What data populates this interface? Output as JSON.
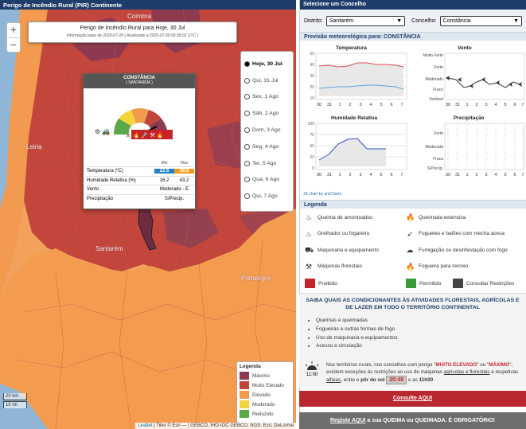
{
  "left_header": "Perigo de Incêndio Rural (PIR) Continente",
  "map": {
    "zoom_in": "+",
    "zoom_out": "−",
    "places": [
      "Coimbra",
      "Leiria",
      "Santarém",
      "Portalegre"
    ],
    "forecast_title": "Perigo de Incêndio Rural para Hoje, 30 Jul",
    "forecast_subtitle": "Informação base de 2025-07-29 ( Atualizado a 2025-07-30 09:35:02 UTC )",
    "days": [
      {
        "label": "Hoje, 30 Jul",
        "selected": true
      },
      {
        "label": "Qui, 31 Jul",
        "selected": false
      },
      {
        "label": "Sex, 1 Ago",
        "selected": false
      },
      {
        "label": "Sáb, 2 Ago",
        "selected": false
      },
      {
        "label": "Dom, 3 Ago",
        "selected": false
      },
      {
        "label": "Seg, 4 Ago",
        "selected": false
      },
      {
        "label": "Ter, 5 Ago",
        "selected": false
      },
      {
        "label": "Qua, 6 Ago",
        "selected": false
      },
      {
        "label": "Qui, 7 Ago",
        "selected": false
      }
    ],
    "popup": {
      "name": "CONSTÂNCIA",
      "district": "( SANTARÉM )",
      "col_min": "Min",
      "col_max": "Max",
      "temperature_label": "Temperatura (ºC)",
      "temperature_min": "22.6",
      "temperature_max": "38.6",
      "humidity_label": "Humidade Relativa (%)",
      "humidity_min": "16.2",
      "humidity_max": "43.2",
      "wind_label": "Vento",
      "wind_value": "Moderado - E",
      "precip_label": "Precipitação",
      "precip_value": "S/Precip."
    },
    "legend": {
      "title": "Legenda",
      "items": [
        {
          "label": "Máximo",
          "color": "#8c3a4e"
        },
        {
          "label": "Muito Elevado",
          "color": "#c2453a"
        },
        {
          "label": "Elevado",
          "color": "#f19a4b"
        },
        {
          "label": "Moderado",
          "color": "#f5d53c"
        },
        {
          "label": "Reduzido",
          "color": "#5aa84a"
        }
      ]
    },
    "scale_km": "20 km",
    "scale_mi": "10 mi",
    "attribution_leaflet": "Leaflet",
    "attribution_rest": " | Tiles © Esri — | GEBCO, IHO-IOC GEBCO, NGS, Esri, DeLorme"
  },
  "right": {
    "header": "Selecione um Concelho",
    "district_label": "Distrito:",
    "district_value": "Santarém",
    "municipality_label": "Concelho:",
    "municipality_value": "Constância",
    "forecast_header": "Previsão meteorológica para: CONSTÂNCIA",
    "chart_titles": [
      "Temperatura",
      "Vento",
      "Humidade Relativa",
      "Precipitação"
    ],
    "x_ticks": [
      "30",
      "31",
      "1",
      "2",
      "3",
      "4",
      "5",
      "6",
      "7"
    ],
    "wind_levels": [
      "Muito Forte",
      "Forte",
      "Moderado",
      "Fraco",
      "Variável"
    ],
    "precip_levels": [
      "Forte",
      "Moderada",
      "Fraca",
      "S/Precip."
    ],
    "chart_credit": "JS chart by amCharts",
    "legend_header": "Legenda",
    "activities": [
      {
        "icon": "fire-pile-icon",
        "label": "Queima de amontoados"
      },
      {
        "icon": "extensive-fire-icon",
        "label": "Queimada extensiva"
      },
      {
        "icon": "grill-icon",
        "label": "Grelhador ou fogareiro"
      },
      {
        "icon": "rocket-icon",
        "label": "Foguetes e balões com mecha acesa"
      },
      {
        "icon": "tractor-icon",
        "label": "Maquinaria e equipamento"
      },
      {
        "icon": "fumigation-icon",
        "label": "Fumigação ou desinfestação com fogo"
      },
      {
        "icon": "chainsaw-icon",
        "label": "Máquinas florestais"
      },
      {
        "icon": "campfire-icon",
        "label": "Fogueira para recreio"
      }
    ],
    "status": [
      {
        "label": "Proibido",
        "color": "#c4232a"
      },
      {
        "label": "Permitido",
        "color": "#3a9a3a"
      },
      {
        "label": "Consultar Restrições",
        "color": "#444444"
      }
    ],
    "info_title": "SAIBA QUAIS AS CONDICIONANTES ÀS ATIVIDADES FLORESTAIS, AGRÍCOLAS E DE LAZER EM TODO O TERRITÓRIO CONTINENTAL",
    "info_items": [
      "Queimas e queimadas",
      "Fogueiras e outras formas de fogo",
      "Uso de maquinaria e equipamentos",
      "Acesso e circulação"
    ],
    "sun_time": "11:00",
    "notice_1": "Nos territórios rurais, nos concelhos com perigo \"",
    "notice_very_high": "MUITO ELEVADO",
    "notice_2": "\" ou \"",
    "notice_max": "MÁXIMO",
    "notice_3": "\", existem exceções às restrições ao uso de máquinas ",
    "notice_link1": "agrícolas e florestais",
    "notice_4": " e respetivas ",
    "notice_link2": "alfaias",
    "notice_5": ", entre o ",
    "notice_sunset": "pôr do sol",
    "notice_time": "20:49",
    "notice_6": " e as ",
    "notice_11": "11h00",
    "consult_button": "Consulte AQUI",
    "register_link": "Registe AQUI",
    "register_text": " a sua QUEIMA ou QUEIMADA. É OBRIGATÓRIO!"
  }
}
